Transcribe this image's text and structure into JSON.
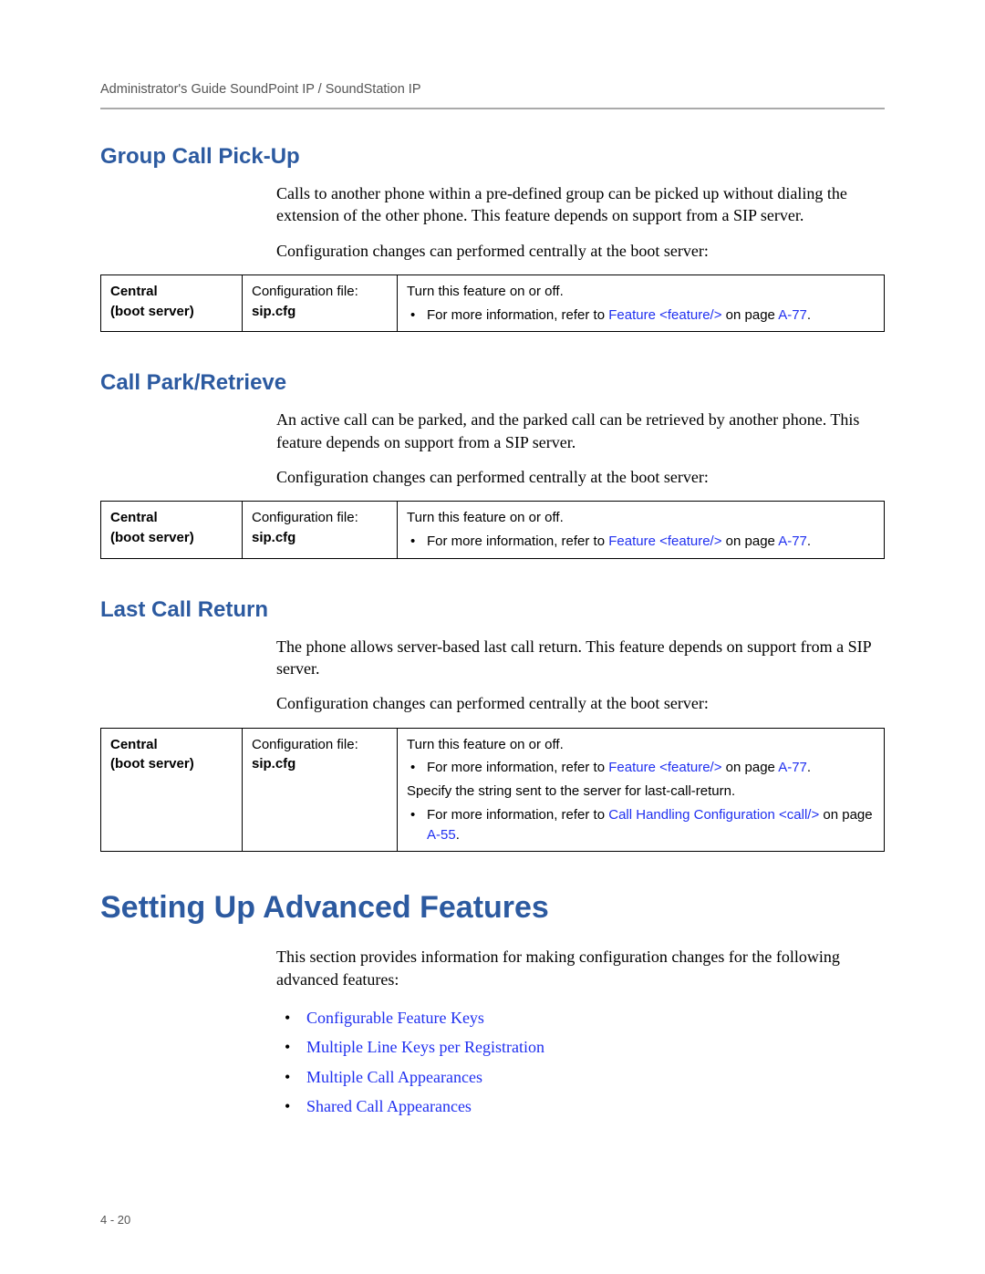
{
  "header": "Administrator's Guide SoundPoint IP / SoundStation IP",
  "pageNumber": "4 - 20",
  "sections": {
    "groupCallPickup": {
      "heading": "Group Call Pick-Up",
      "para1": "Calls to another phone within a pre-defined group can be picked up without dialing the extension of the other phone. This feature depends on support from a SIP server.",
      "para2": "Configuration changes can performed centrally at the boot server:",
      "table": {
        "col1a": "Central",
        "col1b": "(boot server)",
        "col2a": "Configuration file:",
        "col2b": "sip.cfg",
        "col3a": "Turn this feature on or off.",
        "col3b_pre": "For more information, refer to ",
        "col3b_link": "Feature <feature/>",
        "col3b_mid": " on page ",
        "col3b_page": "A-77",
        "col3b_post": "."
      }
    },
    "callParkRetrieve": {
      "heading": "Call Park/Retrieve",
      "para1": "An active call can be parked, and the parked call can be retrieved by another phone. This feature depends on support from a SIP server.",
      "para2": "Configuration changes can performed centrally at the boot server:",
      "table": {
        "col1a": "Central",
        "col1b": "(boot server)",
        "col2a": "Configuration file:",
        "col2b": "sip.cfg",
        "col3a": "Turn this feature on or off.",
        "col3b_pre": "For more information, refer to ",
        "col3b_link": "Feature <feature/>",
        "col3b_mid": " on page ",
        "col3b_page": "A-77",
        "col3b_post": "."
      }
    },
    "lastCallReturn": {
      "heading": "Last Call Return",
      "para1": "The phone allows server-based last call return. This feature depends on support from a SIP server.",
      "para2": "Configuration changes can performed centrally at the boot server:",
      "table": {
        "col1a": "Central",
        "col1b": "(boot server)",
        "col2a": "Configuration file:",
        "col2b": "sip.cfg",
        "col3a": "Turn this feature on or off.",
        "col3b_pre": "For more information, refer to ",
        "col3b_link": "Feature <feature/>",
        "col3b_mid": " on page ",
        "col3b_page": "A-77",
        "col3b_post": ".",
        "col3c": "Specify the string sent to the server for last-call-return.",
        "col3d_pre": "For more information, refer to ",
        "col3d_link": "Call Handling Configuration <call/>",
        "col3d_mid": " on page ",
        "col3d_page": "A-55",
        "col3d_post": "."
      }
    },
    "advancedFeatures": {
      "heading": "Setting Up Advanced Features",
      "para1": "This section provides information for making configuration changes for the following advanced features:",
      "items": {
        "0": "Configurable Feature Keys",
        "1": "Multiple Line Keys per Registration",
        "2": "Multiple Call Appearances",
        "3": "Shared Call Appearances"
      }
    }
  }
}
